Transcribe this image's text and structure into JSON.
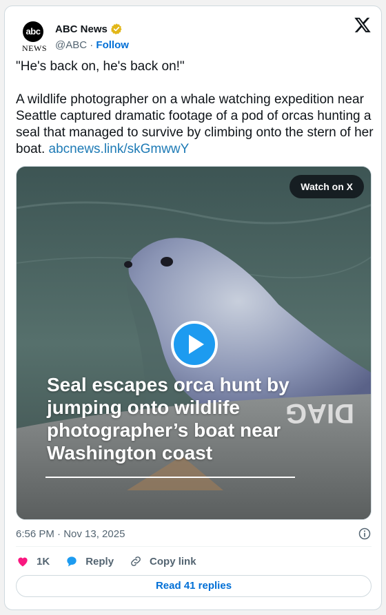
{
  "account": {
    "display_name": "ABC News",
    "handle": "@ABC",
    "separator": "·",
    "follow_label": "Follow",
    "logo_text": "abc",
    "logo_subtext": "NEWS"
  },
  "tweet": {
    "body": "\"He's back on, he's back on!\"\n\nA wildlife photographer on a whale watching expedition near Seattle captured dramatic footage of a pod of orcas hunting a seal that managed to survive by climbing onto the stern of her boat. ",
    "link_text": "abcnews.link/skGmwwY",
    "timestamp": "6:56 PM · Nov 13, 2025"
  },
  "media": {
    "watch_label": "Watch on X",
    "caption": "Seal escapes orca hunt by jumping onto wildlife photographer’s boat near Washington coast",
    "boat_text": "DIAG"
  },
  "actions": {
    "likes": "1K",
    "reply_label": "Reply",
    "copy_label": "Copy link",
    "read_replies": "Read 41 replies"
  },
  "icons": {
    "verified": "verified-badge-icon",
    "x_logo": "x-logo-icon",
    "info": "info-icon",
    "heart": "heart-icon",
    "reply": "reply-bubble-icon",
    "link": "link-icon",
    "play": "play-icon"
  },
  "colors": {
    "heart": "#f91880",
    "reply": "#1d9bf0",
    "link": "#1d7ab5",
    "verified": "#e2b719"
  }
}
